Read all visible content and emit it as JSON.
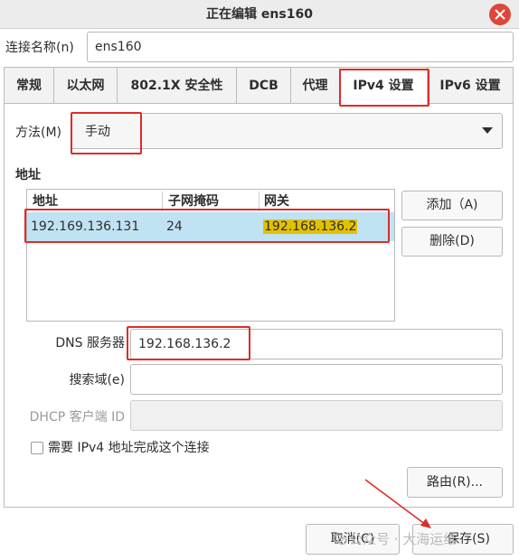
{
  "window": {
    "title": "正在编辑 ens160"
  },
  "connection": {
    "name_label": "连接名称(n)",
    "name_value": "ens160"
  },
  "tabs": [
    {
      "label": "常规"
    },
    {
      "label": "以太网"
    },
    {
      "label": "802.1X 安全性"
    },
    {
      "label": "DCB"
    },
    {
      "label": "代理"
    },
    {
      "label": "IPv4 设置",
      "selected": true
    },
    {
      "label": "IPv6 设置"
    }
  ],
  "ipv4": {
    "method_label": "方法(M)",
    "method_value": "手动",
    "address_section_title": "地址",
    "table": {
      "columns": [
        "地址",
        "子网掩码",
        "网关"
      ],
      "rows": [
        {
          "address": "192.169.136.131",
          "netmask": "24",
          "gateway": "192.168.136.2"
        }
      ]
    },
    "add_button": "添加（A)",
    "delete_button": "删除(D)",
    "dns_label": "DNS 服务器",
    "dns_value": "192.168.136.2",
    "search_domain_label": "搜索域(e)",
    "search_domain_value": "",
    "dhcp_client_id_label": "DHCP 客户端 ID",
    "dhcp_client_id_value": "",
    "require_ipv4_label": "需要 IPv4 地址完成这个连接",
    "require_ipv4_checked": false,
    "routes_button": "路由(R)..."
  },
  "footer": {
    "cancel_button": "取消(C)",
    "save_button": "保存(S)"
  },
  "watermark": "公众号 · 大海运维",
  "colors": {
    "highlight_red": "#e02b27",
    "selected_row": "#bfe3f2",
    "gateway_highlight": "#e2c200",
    "close_button": "#e0453a"
  }
}
